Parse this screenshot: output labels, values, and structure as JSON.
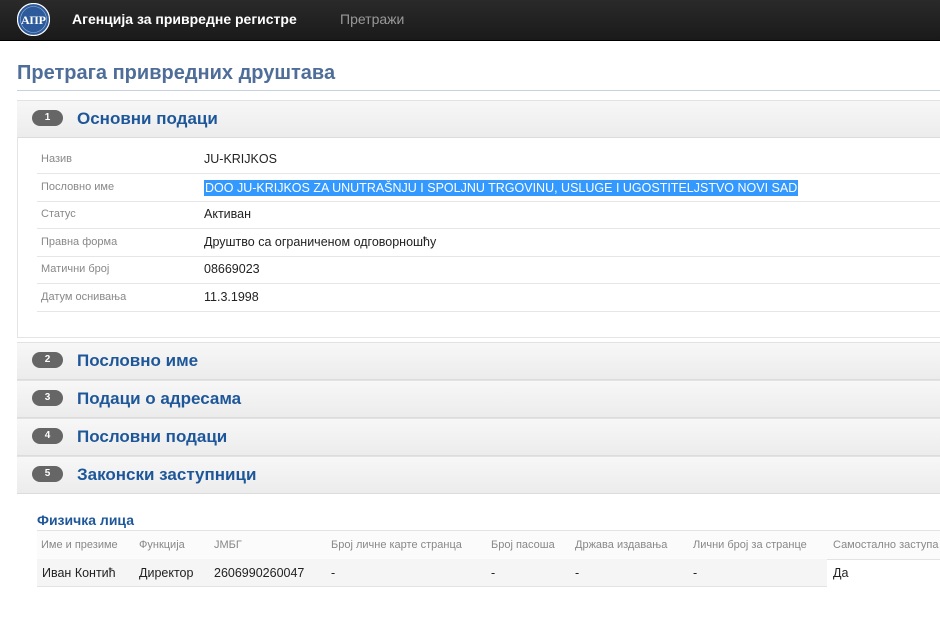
{
  "header": {
    "logo_text": "АПР",
    "brand": "Агенција за привредне регистре",
    "nav_search": "Претражи"
  },
  "page_title": "Претрага привредних друштава",
  "sections": [
    {
      "number": "1",
      "title": "Основни подаци"
    },
    {
      "number": "2",
      "title": "Пословно име"
    },
    {
      "number": "3",
      "title": "Подаци о адресама"
    },
    {
      "number": "4",
      "title": "Пословни подаци"
    },
    {
      "number": "5",
      "title": "Законски заступници"
    }
  ],
  "basic_data": [
    {
      "label": "Назив",
      "value": "JU-KRIJKOS"
    },
    {
      "label": "Пословно име",
      "value": "DOO JU-KRIJKOS ZA UNUTRAŠNJU I SPOLJNU TRGOVINU, USLUGE I UGOSTITELJSTVO NOVI SAD"
    },
    {
      "label": "Статус",
      "value": "Активан"
    },
    {
      "label": "Правна форма",
      "value": "Друштво са ограниченом одговорношћу"
    },
    {
      "label": "Матични број",
      "value": "08669023"
    },
    {
      "label": "Датум оснивања",
      "value": "11.3.1998"
    }
  ],
  "representatives": {
    "subheading": "Физичка лица",
    "columns": [
      "Име и презиме",
      "Функција",
      "ЈМБГ",
      "Број личне карте странца",
      "Број пасоша",
      "Држава издавања",
      "Лични број за странце",
      "Самостално заступа"
    ],
    "rows": [
      [
        "Иван Контић",
        "Директор",
        "2606990260047",
        "-",
        "-",
        "-",
        "-",
        "Да"
      ]
    ]
  },
  "colors": {
    "topbar": "#1f1f1f",
    "title": "#4e6e99",
    "section_title": "#1e5799",
    "badge": "#666666",
    "selection": "#3399ff"
  }
}
